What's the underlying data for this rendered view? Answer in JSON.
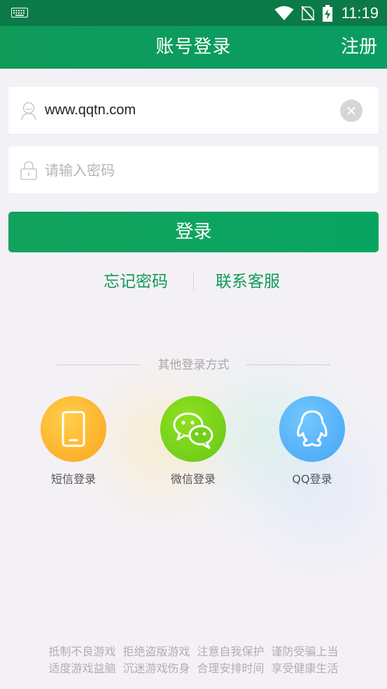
{
  "status_bar": {
    "time": "11:19",
    "icons": [
      "keyboard-icon",
      "wifi-icon",
      "no-sim-icon",
      "battery-charging-icon"
    ]
  },
  "header": {
    "title": "账号登录",
    "register_label": "注册"
  },
  "form": {
    "username": {
      "value": "www.qqtn.com",
      "icon": "user-icon"
    },
    "password": {
      "placeholder": "请输入密码",
      "icon": "lock-icon"
    },
    "login_label": "登录"
  },
  "links": {
    "forgot_password": "忘记密码",
    "contact_service": "联系客服"
  },
  "other_login": {
    "label": "其他登录方式",
    "items": [
      {
        "label": "短信登录",
        "icon": "phone-icon",
        "color": "#fdb12c"
      },
      {
        "label": "微信登录",
        "icon": "wechat-icon",
        "color": "#74cf1a"
      },
      {
        "label": "QQ登录",
        "icon": "qq-icon",
        "color": "#52b0f7"
      }
    ]
  },
  "footer": {
    "line1": [
      "抵制不良游戏",
      "拒绝盗版游戏",
      "注意自我保护",
      "谨防受骗上当"
    ],
    "line2": [
      "适度游戏益脑",
      "沉迷游戏伤身",
      "合理安排时间",
      "享受健康生活"
    ]
  },
  "colors": {
    "primary_green": "#0f9a5a",
    "status_bar": "#0b7a48",
    "link_green": "#109a5a"
  }
}
